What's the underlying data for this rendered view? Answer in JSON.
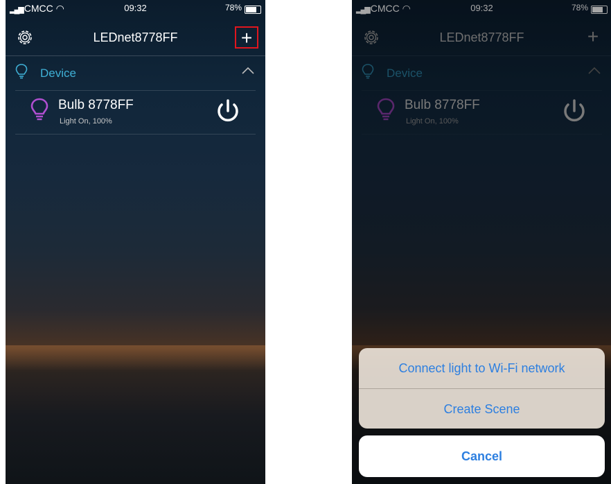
{
  "status_bar": {
    "carrier": "CMCC",
    "time": "09:32",
    "battery": "78%"
  },
  "navbar": {
    "title": "LEDnet8778FF",
    "add_symbol": "+"
  },
  "section": {
    "label": "Device"
  },
  "device": {
    "name": "Bulb 8778FF",
    "status": "Light On, 100%"
  },
  "action_sheet": {
    "items": [
      "Connect light to Wi-Fi network",
      "Create Scene"
    ],
    "cancel": "Cancel"
  },
  "colors": {
    "accent": "#3fb0d6",
    "bulb": "#b04fd0",
    "highlight": "#e0161e",
    "ios_blue": "#2d7fe0"
  },
  "icons": [
    "gear-icon",
    "plus-icon",
    "lightbulb-outline-icon",
    "chevron-up-icon",
    "lightbulb-icon",
    "power-icon",
    "wifi-icon",
    "battery-icon"
  ]
}
